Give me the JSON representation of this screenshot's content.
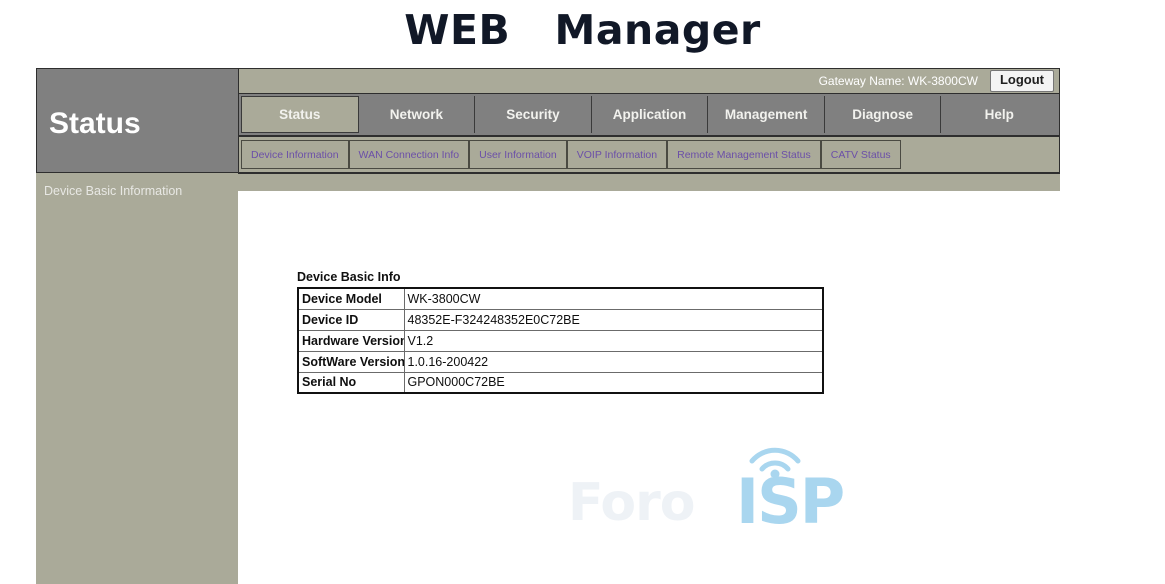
{
  "page": {
    "title": "WEB   Manager"
  },
  "topbar": {
    "gateway_label": "Gateway Name: WK-3800CW",
    "logout_label": "Logout"
  },
  "sidebar": {
    "section_title": "Status",
    "items": [
      {
        "label": "Device Basic Information"
      }
    ]
  },
  "mainnav": {
    "active": "Status",
    "items": [
      {
        "label": "Status"
      },
      {
        "label": "Network"
      },
      {
        "label": "Security"
      },
      {
        "label": "Application"
      },
      {
        "label": "Management"
      },
      {
        "label": "Diagnose"
      },
      {
        "label": "Help"
      }
    ]
  },
  "subnav": {
    "items": [
      {
        "label": "Device Information"
      },
      {
        "label": "WAN Connection Info"
      },
      {
        "label": "User Information"
      },
      {
        "label": "VOIP Information"
      },
      {
        "label": "Remote Management Status"
      },
      {
        "label": "CATV Status"
      }
    ]
  },
  "content": {
    "table": {
      "caption": "Device Basic Info",
      "rows": [
        {
          "key": "Device Model",
          "value": "WK-3800CW"
        },
        {
          "key": "Device ID",
          "value": "48352E-F324248352E0C72BE"
        },
        {
          "key": "Hardware Version",
          "value": "V1.2"
        },
        {
          "key": "SoftWare Version",
          "value": "1.0.16-200422"
        },
        {
          "key": "Serial No",
          "value": "GPON000C72BE"
        }
      ]
    }
  },
  "watermark": {
    "text_left": "Foro",
    "text_right": "ISP"
  },
  "colors": {
    "tan": "#aaaa99",
    "gray": "#808080",
    "subnav_text": "#6b4fa8",
    "watermark_blue": "#a9d6ef"
  }
}
